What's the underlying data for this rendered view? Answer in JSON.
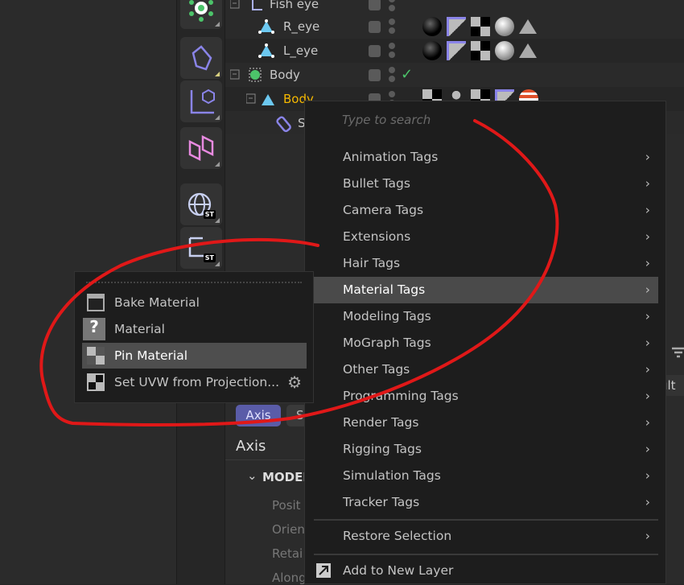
{
  "objects": [
    {
      "name": "Fish eye",
      "icon": "null-axis-icon",
      "tags": []
    },
    {
      "name": "R_eye",
      "icon": "polygon-object-icon",
      "tags": [
        "material-tag-black",
        "phong-tag",
        "uvw-tag",
        "material-tag-white",
        "triangle-tag"
      ]
    },
    {
      "name": "L_eye",
      "icon": "polygon-object-icon",
      "tags": [
        "material-tag-black",
        "phong-tag",
        "uvw-tag",
        "material-tag-white",
        "triangle-tag"
      ]
    },
    {
      "name": "Body",
      "icon": "null-object-icon",
      "check": "✓",
      "tags": []
    },
    {
      "name": "Body",
      "icon": "polygon-object-icon",
      "selected": true,
      "tags": [
        "pin-material-tag",
        "weight-tag",
        "uvw-tag",
        "phong-tag",
        "material-tag-striped"
      ]
    },
    {
      "name": "S",
      "icon": "skin-icon",
      "tags": []
    }
  ],
  "attributes": {
    "tabs": [
      "Axis",
      "S"
    ],
    "heading": "Axis",
    "section": "MODEL",
    "fields": [
      "Posit",
      "Orien",
      "Retai",
      "Along"
    ],
    "right_partial": "ult"
  },
  "context_menu": {
    "search_placeholder": "Type to search",
    "items": [
      {
        "label": "Animation Tags"
      },
      {
        "label": "Bullet Tags"
      },
      {
        "label": "Camera Tags"
      },
      {
        "label": "Extensions"
      },
      {
        "label": "Hair Tags"
      },
      {
        "label": "Material Tags",
        "highlighted": true
      },
      {
        "label": "Modeling Tags"
      },
      {
        "label": "MoGraph Tags"
      },
      {
        "label": "Other Tags"
      },
      {
        "label": "Programming Tags"
      },
      {
        "label": "Render Tags"
      },
      {
        "label": "Rigging Tags"
      },
      {
        "label": "Simulation Tags"
      },
      {
        "label": "Tracker Tags"
      }
    ],
    "restore": "Restore Selection",
    "add_layer": "Add to New Layer",
    "chevron": "›"
  },
  "submenu": {
    "items": [
      {
        "label": "Bake Material",
        "icon": "bake-material-icon"
      },
      {
        "label": "Material",
        "icon": "material-unknown-icon"
      },
      {
        "label": "Pin Material",
        "icon": "pin-material-icon",
        "highlighted": true
      },
      {
        "label": "Set UVW from Projection...",
        "icon": "uvw-icon",
        "gear": true
      }
    ]
  },
  "colors": {
    "accent": "#5a5ca8",
    "highlight": "#4a4a4a",
    "selected_name": "#f5b800",
    "annotation": "#e01818",
    "check": "#4cc46a"
  }
}
